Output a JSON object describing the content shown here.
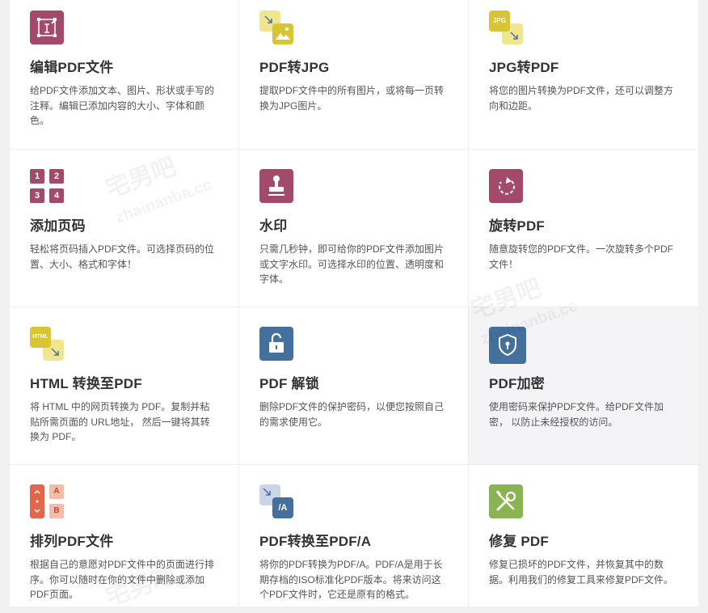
{
  "tools": [
    {
      "name": "edit-pdf",
      "title": "编辑PDF文件",
      "desc": "给PDF文件添加文本、图片、形状或手写的注释。编辑已添加内容的大小、字体和颜色。",
      "icon": "edit-pdf-icon"
    },
    {
      "name": "pdf-to-jpg",
      "title": "PDF转JPG",
      "desc": "提取PDF文件中的所有图片，或将每一页转换为JPG图片。",
      "icon": "pdf-to-jpg-icon"
    },
    {
      "name": "jpg-to-pdf",
      "title": "JPG转PDF",
      "desc": "将您的图片转换为PDF文件，还可以调整方向和边距。",
      "icon": "jpg-to-pdf-icon",
      "icon_label": "JPG"
    },
    {
      "name": "add-page-numbers",
      "title": "添加页码",
      "desc": "轻松将页码插入PDF文件。可选择页码的位置、大小、格式和字体！",
      "icon": "page-numbers-icon",
      "icon_numbers": [
        "1",
        "2",
        "3",
        "4"
      ]
    },
    {
      "name": "watermark",
      "title": "水印",
      "desc": "只需几秒钟，即可给你的PDF文件添加图片或文字水印。可选择水印的位置、透明度和字体。",
      "icon": "stamp-icon"
    },
    {
      "name": "rotate-pdf",
      "title": "旋转PDF",
      "desc": "随意旋转您的PDF文件。一次旋转多个PDF文件！",
      "icon": "rotate-icon"
    },
    {
      "name": "html-to-pdf",
      "title": "HTML 转换至PDF",
      "desc": "将 HTML 中的网页转换为 PDF。复制并粘贴所需页面的 URL地址， 然后一键将其转换为 PDF。",
      "icon": "html-to-pdf-icon",
      "icon_label": "HTML"
    },
    {
      "name": "unlock-pdf",
      "title": "PDF 解锁",
      "desc": "删除PDF文件的保护密码，以便您按照自己的需求使用它。",
      "icon": "unlock-icon"
    },
    {
      "name": "protect-pdf",
      "title": "PDF加密",
      "desc": "使用密码来保护PDF文件。给PDF文件加密， 以防止未经授权的访问。",
      "icon": "shield-lock-icon"
    },
    {
      "name": "organize-pdf",
      "title": "排列PDF文件",
      "desc": "根据自己的意愿对PDF文件中的页面进行排序。你可以随时在你的文件中删除或添加PDF页面。",
      "icon": "organize-icon",
      "icon_letters": [
        "A",
        "B"
      ]
    },
    {
      "name": "pdf-to-pdfa",
      "title": "PDF转换至PDF/A",
      "desc": "将你的PDF转换为PDF/A。PDF/A是用于长期存档的ISO标准化PDF版本。将来访问这个PDF文件时，它还是原有的格式。",
      "icon": "pdfa-icon",
      "icon_label": "/A"
    },
    {
      "name": "repair-pdf",
      "title": "修复 PDF",
      "desc": "修复已损坏的PDF文件，并恢复其中的数据。利用我们的修复工具来修复PDF文件。",
      "icon": "repair-icon"
    }
  ],
  "watermark_text": {
    "cn": "宅男吧",
    "en": "zhainanba.cc"
  },
  "colors": {
    "magenta": "#a34a6a",
    "yellow": "#d7c535",
    "yellow_light": "#f0e68f",
    "blue": "#44709d",
    "orange": "#e4664a",
    "peach": "#f5bda9",
    "green": "#8ab452",
    "hover_bg": "#f4f4f6"
  }
}
